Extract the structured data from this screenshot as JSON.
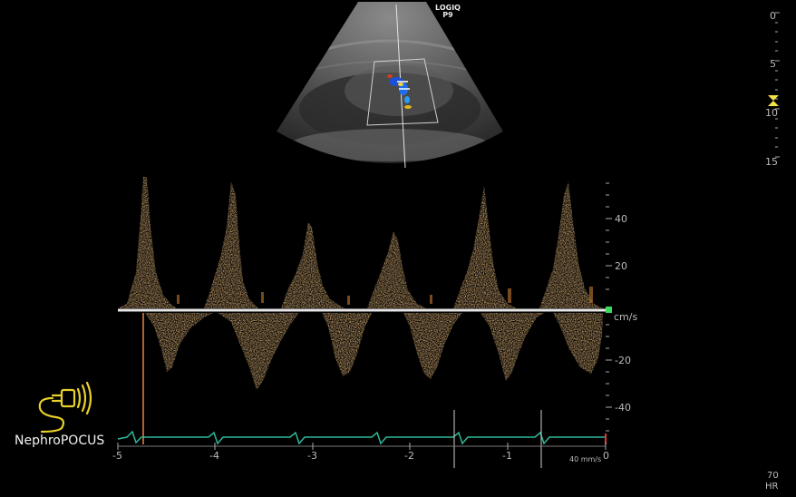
{
  "scanner": {
    "brand": "LOGIQ",
    "model": "P9"
  },
  "depth_scale": {
    "labels": [
      "0",
      "5",
      "10",
      "15"
    ],
    "unit": "cm"
  },
  "velocity_scale": {
    "labels": [
      "40",
      "20",
      "-20",
      "-40"
    ],
    "unit": "cm/s"
  },
  "time_axis": {
    "labels": [
      "-5",
      "-4",
      "-3",
      "-2",
      "-1",
      "0"
    ]
  },
  "sweep_speed": "40 mm/s",
  "heart_rate": {
    "value": "70",
    "label": "HR"
  },
  "logo": {
    "text": "NephroPOCUS",
    "color": "#e8d12a"
  },
  "colors": {
    "doppler": "#f0a040",
    "ecg": "#2fb89a",
    "baseline": "#e6e6e6",
    "focus_marker": "#f3e14a"
  }
}
